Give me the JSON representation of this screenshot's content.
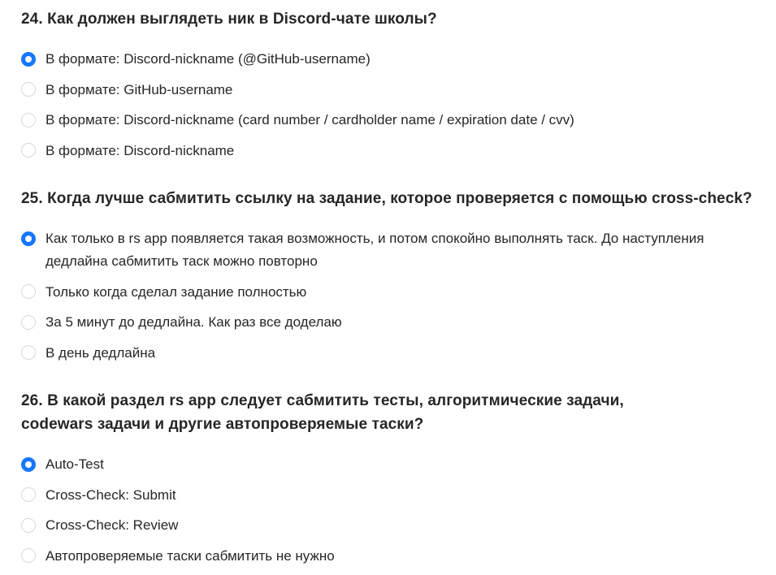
{
  "questions": [
    {
      "title": "24. Как должен выглядеть ник в Discord-чате школы?",
      "options": [
        {
          "label": "В формате: Discord-nickname (@GitHub-username)",
          "selected": true
        },
        {
          "label": "В формате: GitHub-username",
          "selected": false
        },
        {
          "label": "В формате: Discord-nickname (card number / cardholder name / expiration date / cvv)",
          "selected": false
        },
        {
          "label": "В формате: Discord-nickname",
          "selected": false
        }
      ]
    },
    {
      "title": "25. Когда лучше сабмитить ссылку на задание, которое проверяется с помощью cross-check?",
      "options": [
        {
          "label": "Как только в rs app появляется такая возможность, и потом спокойно выполнять таск. До наступления дедлайна сабмитить таск можно повторно",
          "selected": true
        },
        {
          "label": "Только когда сделал задание полностью",
          "selected": false
        },
        {
          "label": "За 5 минут до дедлайна. Как раз все доделаю",
          "selected": false
        },
        {
          "label": "В день дедлайна",
          "selected": false
        }
      ]
    },
    {
      "title": "26. В какой раздел rs app следует сабмитить тесты, алгоритмические задачи, codewars задачи и другие автопроверяемые таски?",
      "options": [
        {
          "label": "Auto-Test",
          "selected": true
        },
        {
          "label": "Cross-Check: Submit",
          "selected": false
        },
        {
          "label": "Cross-Check: Review",
          "selected": false
        },
        {
          "label": "Автопроверяемые таски сабмитить не нужно",
          "selected": false
        }
      ]
    }
  ],
  "colors": {
    "accent": "#1677ff",
    "text": "#262626",
    "radio_border": "#d9d9d9"
  }
}
